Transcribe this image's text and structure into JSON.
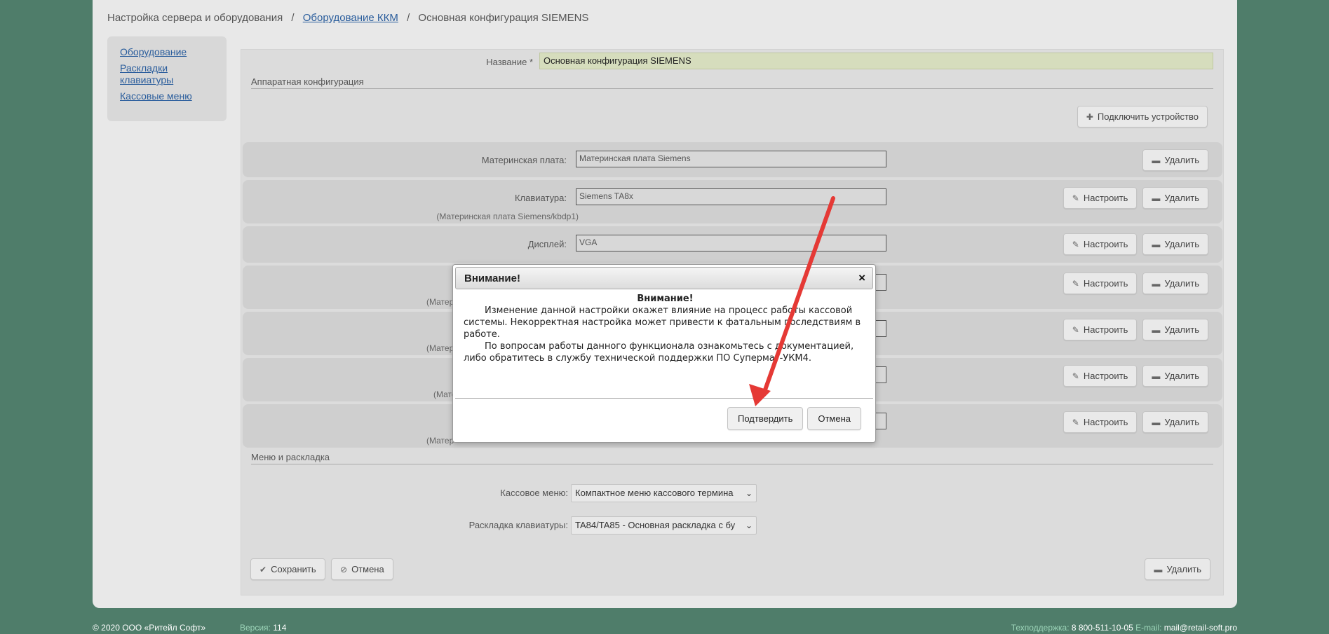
{
  "breadcrumb": {
    "root": "Настройка сервера и оборудования",
    "link": "Оборудование ККМ",
    "current": "Основная конфигурация SIEMENS",
    "separator": "/"
  },
  "sidebar": {
    "items": [
      {
        "label": "Оборудование"
      },
      {
        "label": "Раскладки клавиатуры"
      },
      {
        "label": "Кассовые меню"
      }
    ]
  },
  "form": {
    "name_label": "Название *",
    "name_value": "Основная конфигурация SIEMENS",
    "hw_section_title": "Аппаратная конфигурация",
    "connect_button": "Подключить устройство",
    "menu_section_title": "Меню и раскладка",
    "cash_menu_label": "Кассовое меню:",
    "cash_menu_value": "Компактное меню кассового термина",
    "keyboard_layout_label": "Раскладка клавиатуры:",
    "keyboard_layout_value": "TA84/TA85 - Основная раскладка с бу",
    "save_button": "Сохранить",
    "cancel_button": "Отмена",
    "delete_button": "Удалить"
  },
  "devices": [
    {
      "label": "Материнская плата:",
      "value": "Материнская плата Siemens",
      "sub": ""
    },
    {
      "label": "Клавиатура:",
      "value": "Siemens TA8x",
      "sub": "(Материнская плата Siemens/kbdp1)"
    },
    {
      "label": "Дисплей:",
      "value": "VGA",
      "sub": ""
    },
    {
      "label": "",
      "value": "",
      "sub": "(Матер"
    },
    {
      "label": "",
      "value": "",
      "sub": "(Матер"
    },
    {
      "label": "",
      "value": "",
      "sub": "(Мате"
    },
    {
      "label": "",
      "value": "",
      "sub": "(Матер"
    }
  ],
  "device_buttons": {
    "configure": "Настроить",
    "delete": "Удалить"
  },
  "dialog": {
    "title": "Внимание!",
    "heading": "Внимание!",
    "paragraph1": "Изменение данной настройки окажет влияние на процесс работы кассовой системы. Некорректная настройка может привести к фатальным последствиям в работе.",
    "paragraph2": "По вопросам работы данного функционала ознакомьтесь с документацией, либо обратитесь в службу технической поддержки ПО Супермаг-УКМ4.",
    "confirm_button": "Подтвердить",
    "cancel_button": "Отмена",
    "close_glyph": "×"
  },
  "footer": {
    "copyright": "© 2020 ООО «Ритейл Софт»",
    "version_label": "Версия:",
    "version_value": "114",
    "support_label": "Техподдержка:",
    "support_phone": "8 800-511-10-05",
    "email_label": "E-mail:",
    "email_value": "mail@retail-soft.pro"
  },
  "colors": {
    "background": "#4f7d6a",
    "page": "#e8e8e8",
    "name_input": "#d6ddbd",
    "link": "#2a5d9c",
    "arrow": "#e53935"
  }
}
